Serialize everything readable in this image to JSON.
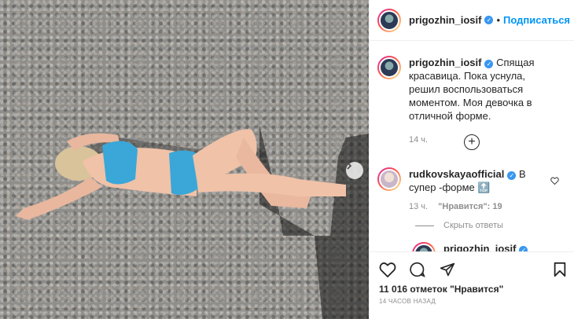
{
  "post": {
    "author": "prigozhin_iosif",
    "follow_label": "Подписаться",
    "separator": "•",
    "caption": "Спящая красавица. Пока уснула, решил воспользоваться моментом. Моя девочка в отличной форме.",
    "caption_time": "14 ч.",
    "likes": "11 016 отметок \"Нравится\"",
    "timestamp": "14 ЧАСОВ НАЗАД"
  },
  "comments": [
    {
      "user": "rudkovskayaofficial",
      "text": "В супер -форме",
      "emoji": "🔝",
      "time": "13 ч.",
      "likes": "\"Нравится\": 19",
      "hide_replies": "Скрыть ответы"
    }
  ],
  "reply": {
    "user": "prigozhin_iosif"
  },
  "icons": [
    "heart-icon",
    "comment-icon",
    "share-icon",
    "bookmark-icon",
    "add-comment-icon",
    "verified-icon",
    "chevron-right-icon"
  ],
  "colors": {
    "accent": "#0095f6",
    "verified": "#3897f0",
    "swimsuit": "#3aa7d8"
  }
}
